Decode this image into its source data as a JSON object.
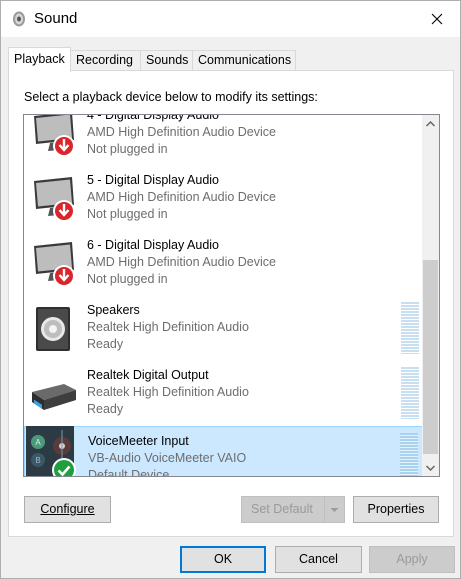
{
  "window": {
    "title": "Sound",
    "close_icon": "close-icon"
  },
  "tabs": [
    {
      "label": "Playback",
      "active": true
    },
    {
      "label": "Recording",
      "active": false
    },
    {
      "label": "Sounds",
      "active": false
    },
    {
      "label": "Communications",
      "active": false
    }
  ],
  "instruction": "Select a playback device below to modify its settings:",
  "devices": [
    {
      "name": "4 - Digital Display Audio",
      "driver": "AMD High Definition Audio Device",
      "status": "Not plugged in",
      "icon": "monitor-icon",
      "badge": "unplugged-badge-icon",
      "selected": false
    },
    {
      "name": "5 - Digital Display Audio",
      "driver": "AMD High Definition Audio Device",
      "status": "Not plugged in",
      "icon": "monitor-icon",
      "badge": "unplugged-badge-icon",
      "selected": false
    },
    {
      "name": "6 - Digital Display Audio",
      "driver": "AMD High Definition Audio Device",
      "status": "Not plugged in",
      "icon": "monitor-icon",
      "badge": "unplugged-badge-icon",
      "selected": false
    },
    {
      "name": "Speakers",
      "driver": "Realtek High Definition Audio",
      "status": "Ready",
      "icon": "speaker-icon",
      "badge": "",
      "selected": false
    },
    {
      "name": "Realtek Digital Output",
      "driver": "Realtek High Definition Audio",
      "status": "Ready",
      "icon": "digital-output-icon",
      "badge": "",
      "selected": false
    },
    {
      "name": "VoiceMeeter Input",
      "driver": "VB-Audio VoiceMeeter VAIO",
      "status": "Default Device",
      "icon": "voicemeeter-icon",
      "badge": "default-check-icon",
      "selected": true
    }
  ],
  "buttons": {
    "configure": "Configure",
    "set_default": "Set Default",
    "properties": "Properties",
    "ok": "OK",
    "cancel": "Cancel",
    "apply": "Apply"
  },
  "colors": {
    "selection_bg": "#cce8ff",
    "selection_border": "#99d1ff",
    "default_button_border": "#0078d7",
    "unplugged_badge": "#d9262c",
    "default_check": "#1e9e3e"
  }
}
